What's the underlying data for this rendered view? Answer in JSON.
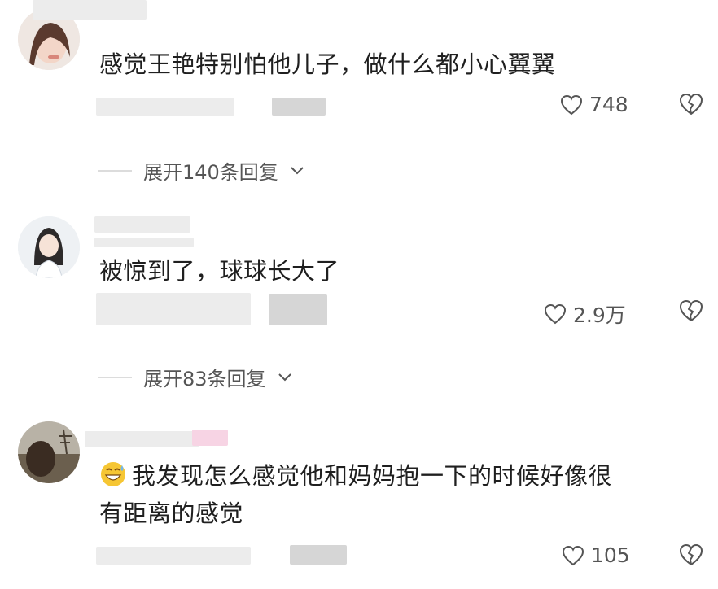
{
  "comments": [
    {
      "text": "感觉王艳特别怕他儿子，做什么都小心翼翼",
      "likes": "748",
      "expand_label": "展开140条回复"
    },
    {
      "text": "被惊到了，球球长大了",
      "likes": "2.9万",
      "expand_label": "展开83条回复"
    },
    {
      "text_line1": "我发现怎么感觉他和妈妈抱一下的时候好像很",
      "text_line2": "有距离的感觉",
      "likes": "105"
    }
  ],
  "icons": {
    "like": "heart-outline-icon",
    "dislike": "broken-heart-icon",
    "expand": "chevron-down-icon",
    "emoji": "grinning-sweat-emoji"
  },
  "colors": {
    "text": "#1f1f1f",
    "secondary": "#555555",
    "blur": "#ececec"
  }
}
